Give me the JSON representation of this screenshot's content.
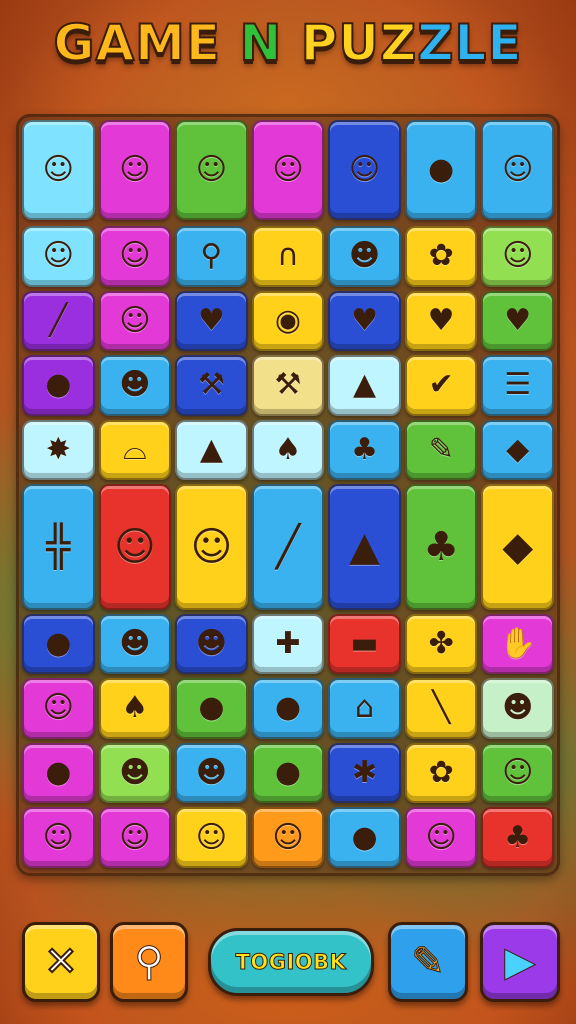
{
  "title": {
    "part1": "GAME ",
    "part2": "N",
    "part3": " PUZ",
    "part4": "ZLE"
  },
  "top_row": [
    {
      "color": "cyan",
      "icon": "hat-face-icon",
      "glyph": "☺"
    },
    {
      "color": "magenta",
      "icon": "hat-face-icon",
      "glyph": "☺"
    },
    {
      "color": "green",
      "icon": "hat-face-icon",
      "glyph": "☺"
    },
    {
      "color": "magenta",
      "icon": "hat-face-icon",
      "glyph": "☺"
    },
    {
      "color": "blue",
      "icon": "hat-face-icon",
      "glyph": "☺"
    },
    {
      "color": "sky",
      "icon": "berry-icon",
      "glyph": "●"
    },
    {
      "color": "sky",
      "icon": "hat-face-icon",
      "glyph": "☺"
    }
  ],
  "grid_tiles": [
    {
      "area": "a1",
      "color": "cyan",
      "icon": "hat-face-icon",
      "glyph": "☺"
    },
    {
      "area": "a2",
      "color": "magenta",
      "icon": "girl-face-icon",
      "glyph": "☺"
    },
    {
      "area": "a3",
      "color": "sky",
      "icon": "magnifier-icon",
      "glyph": "⚲"
    },
    {
      "area": "a4",
      "color": "yellow",
      "icon": "arch-icon",
      "glyph": "∩"
    },
    {
      "area": "a5",
      "color": "sky",
      "icon": "creature-icon",
      "glyph": "☻"
    },
    {
      "area": "a6",
      "color": "yellow",
      "icon": "bush-icon",
      "glyph": "✿"
    },
    {
      "area": "a7",
      "color": "lime",
      "icon": "strawberry-face-icon",
      "glyph": "☺"
    },
    {
      "area": "b1",
      "color": "purple",
      "icon": "ruler-icon",
      "glyph": "╱"
    },
    {
      "area": "b2",
      "color": "magenta",
      "icon": "boy-face-icon",
      "glyph": "☺"
    },
    {
      "area": "b3",
      "color": "blue",
      "icon": "apple-icon",
      "glyph": "♥"
    },
    {
      "area": "b4",
      "color": "yellow",
      "icon": "donut-icon",
      "glyph": "◉"
    },
    {
      "area": "b5",
      "color": "blue",
      "icon": "apple-icon",
      "glyph": "♥"
    },
    {
      "area": "b6",
      "color": "yellow",
      "icon": "apple-icon",
      "glyph": "♥"
    },
    {
      "area": "b7",
      "color": "green",
      "icon": "heart-icon",
      "glyph": "♥"
    },
    {
      "area": "c1",
      "color": "purple",
      "icon": "blueberry-icon",
      "glyph": "●"
    },
    {
      "area": "c2",
      "color": "sky",
      "icon": "slime-icon",
      "glyph": "☻"
    },
    {
      "area": "c3",
      "color": "blue",
      "icon": "hammer-icon",
      "glyph": "⚒"
    },
    {
      "area": "c4",
      "color": "cream",
      "icon": "hammer-icon",
      "glyph": "⚒"
    },
    {
      "area": "c5",
      "color": "pale",
      "icon": "leaf-icon",
      "glyph": "▲"
    },
    {
      "area": "c6",
      "color": "yellow",
      "icon": "check-heart-icon",
      "glyph": "✔"
    },
    {
      "area": "c7",
      "color": "sky",
      "icon": "clipboard-icon",
      "glyph": "☰"
    },
    {
      "area": "d1",
      "color": "pale",
      "icon": "star-splat-icon",
      "glyph": "✸"
    },
    {
      "area": "d2",
      "color": "yellow",
      "icon": "bread-icon",
      "glyph": "⌓"
    },
    {
      "area": "d3",
      "color": "pale",
      "icon": "pear-slime-icon",
      "glyph": "▲"
    },
    {
      "area": "d4",
      "color": "pale",
      "icon": "mushroom-icon",
      "glyph": "♠"
    },
    {
      "area": "d5",
      "color": "sky",
      "icon": "mushroom-icon",
      "glyph": "♣"
    },
    {
      "area": "d6",
      "color": "green",
      "icon": "pencil-icon",
      "glyph": "✎"
    },
    {
      "area": "d7",
      "color": "sky",
      "icon": "drop-icon",
      "glyph": "◆"
    },
    {
      "area": "e1",
      "color": "sky",
      "icon": "wooden-bridge-icon",
      "glyph": "╬"
    },
    {
      "area": "e2",
      "color": "red",
      "icon": "hat-face-icon",
      "glyph": "☺"
    },
    {
      "area": "e3",
      "color": "yellow",
      "icon": "hat-face-icon",
      "glyph": "☺"
    },
    {
      "area": "e4",
      "color": "sky",
      "icon": "log-icon",
      "glyph": "╱"
    },
    {
      "area": "e5",
      "color": "blue",
      "icon": "cone-icon",
      "glyph": "▲"
    },
    {
      "area": "e6",
      "color": "green",
      "icon": "mushroom-icon",
      "glyph": "♣"
    },
    {
      "area": "e7",
      "color": "yellow",
      "icon": "gem-icon",
      "glyph": "◆"
    },
    {
      "area": "f1",
      "color": "blue",
      "icon": "blueberry-icon",
      "glyph": "●"
    },
    {
      "area": "f2",
      "color": "sky",
      "icon": "blob-face-icon",
      "glyph": "☻"
    },
    {
      "area": "f3",
      "color": "blue",
      "icon": "orange-face-icon",
      "glyph": "☻"
    },
    {
      "area": "f4",
      "color": "pale",
      "icon": "cross-leaf-icon",
      "glyph": "✚"
    },
    {
      "area": "f5",
      "color": "red",
      "icon": "roller-icon",
      "glyph": "▬"
    },
    {
      "area": "f6",
      "color": "yellow",
      "icon": "fern-icon",
      "glyph": "✤"
    },
    {
      "area": "f7",
      "color": "magenta",
      "icon": "hand-icon",
      "glyph": "✋"
    },
    {
      "area": "g1",
      "color": "magenta",
      "icon": "smiley-icon",
      "glyph": "☺"
    },
    {
      "area": "g2",
      "color": "yellow",
      "icon": "tree-icon",
      "glyph": "♠"
    },
    {
      "area": "g3",
      "color": "green",
      "icon": "bubble-icon",
      "glyph": "●"
    },
    {
      "area": "g4",
      "color": "sky",
      "icon": "tomato-icon",
      "glyph": "●"
    },
    {
      "area": "g5",
      "color": "sky",
      "icon": "house-icon",
      "glyph": "⌂"
    },
    {
      "area": "g6",
      "color": "yellow",
      "icon": "stick-icon",
      "glyph": "╲"
    },
    {
      "area": "g7",
      "color": "mint",
      "icon": "teddy-icon",
      "glyph": "☻"
    },
    {
      "area": "h1",
      "color": "magenta",
      "icon": "peach-icon",
      "glyph": "●"
    },
    {
      "area": "h2",
      "color": "lime",
      "icon": "lemon-icon",
      "glyph": "☻"
    },
    {
      "area": "h3",
      "color": "sky",
      "icon": "pig-icon",
      "glyph": "☻"
    },
    {
      "area": "h4",
      "color": "green",
      "icon": "pouch-icon",
      "glyph": "●"
    },
    {
      "area": "h5",
      "color": "blue",
      "icon": "broom-icon",
      "glyph": "✱"
    },
    {
      "area": "h6",
      "color": "yellow",
      "icon": "flower-icon",
      "glyph": "✿"
    },
    {
      "area": "h7",
      "color": "green",
      "icon": "smiley-icon",
      "glyph": "☺"
    },
    {
      "area": "i1",
      "color": "magenta",
      "icon": "hat-face-icon",
      "glyph": "☺"
    },
    {
      "area": "i2",
      "color": "magenta",
      "icon": "hat-face-icon",
      "glyph": "☺"
    },
    {
      "area": "i3",
      "color": "yellow",
      "icon": "pear-face-icon",
      "glyph": "☺"
    },
    {
      "area": "i4",
      "color": "orange",
      "icon": "hat-face-icon",
      "glyph": "☺"
    },
    {
      "area": "i5",
      "color": "sky",
      "icon": "mango-icon",
      "glyph": "●"
    },
    {
      "area": "i6",
      "color": "magenta",
      "icon": "hat-face-icon",
      "glyph": "☺"
    },
    {
      "area": "i7",
      "color": "red",
      "icon": "palm-tree-icon",
      "glyph": "♣"
    }
  ],
  "tall_areas": [
    "e1",
    "e2",
    "e3",
    "e4",
    "e5",
    "e6",
    "e7"
  ],
  "buttons": {
    "close_glyph": "✕",
    "hint_glyph": "⚲",
    "toggle_label": "TOGIOBK",
    "pencil_glyph": "✎",
    "play_glyph": "▶"
  }
}
